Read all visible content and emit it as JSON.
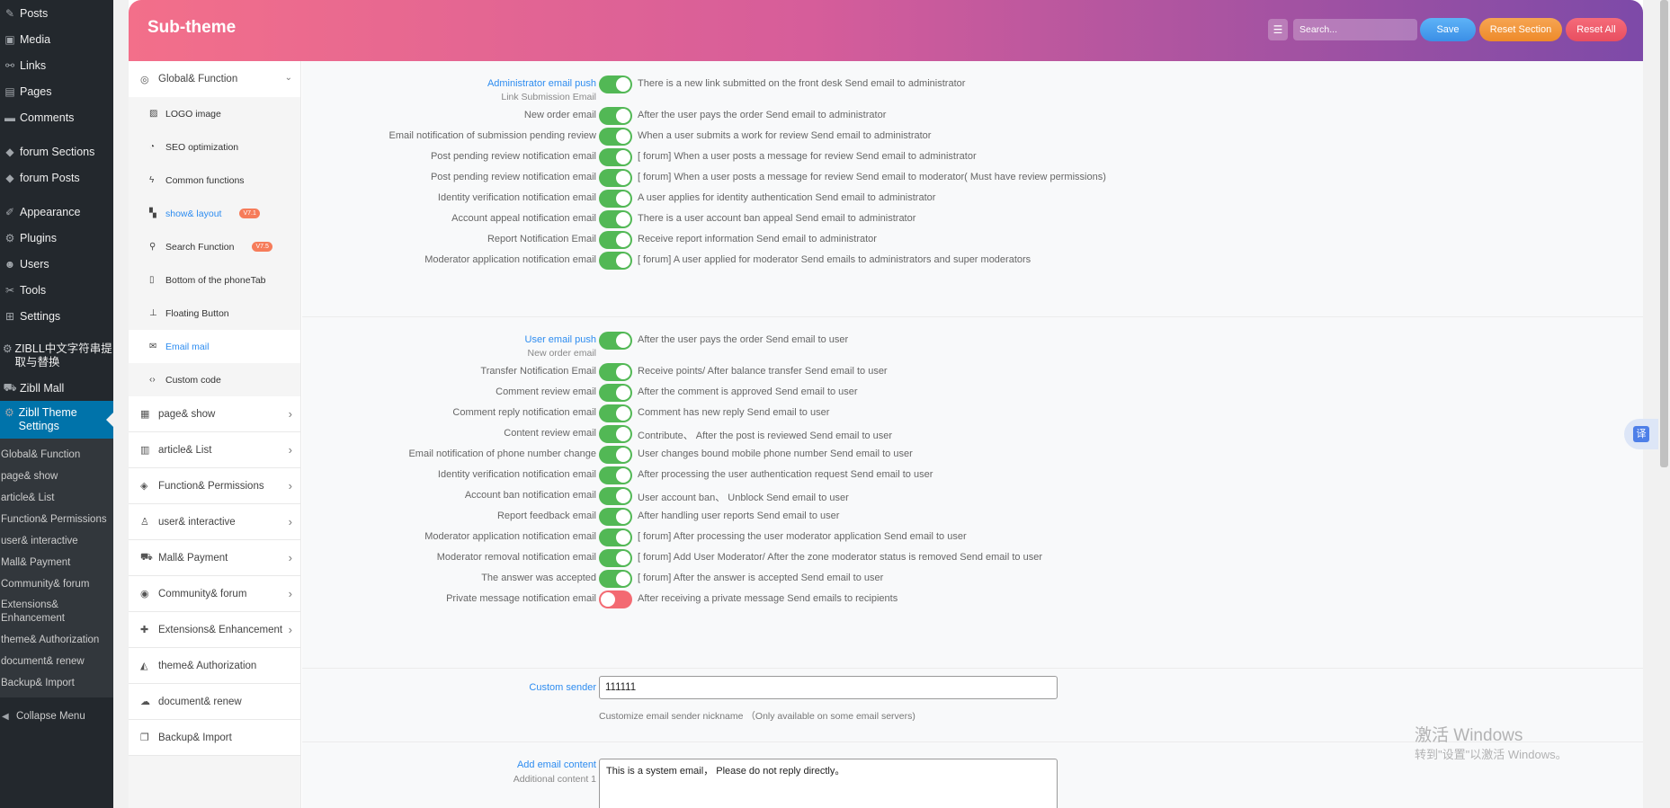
{
  "wp_menu": {
    "items": [
      {
        "icon": "pin-icon",
        "glyph": "✎",
        "label": "Posts"
      },
      {
        "icon": "media-icon",
        "glyph": "▣",
        "label": "Media"
      },
      {
        "icon": "link-icon",
        "glyph": "⚯",
        "label": "Links"
      },
      {
        "icon": "pages-icon",
        "glyph": "▤",
        "label": "Pages"
      },
      {
        "icon": "comments-icon",
        "glyph": "▬",
        "label": "Comments"
      },
      {
        "icon": "forum-icon",
        "glyph": "◆",
        "label": "forum Sections"
      },
      {
        "icon": "forum-posts-icon",
        "glyph": "◆",
        "label": "forum Posts"
      },
      {
        "icon": "appearance-icon",
        "glyph": "✐",
        "label": "Appearance"
      },
      {
        "icon": "plugins-icon",
        "glyph": "⚙",
        "label": "Plugins"
      },
      {
        "icon": "users-icon",
        "glyph": "☻",
        "label": "Users"
      },
      {
        "icon": "tools-icon",
        "glyph": "✂",
        "label": "Tools"
      },
      {
        "icon": "settings-icon",
        "glyph": "⊞",
        "label": "Settings"
      },
      {
        "icon": "gear-icon",
        "glyph": "⚙",
        "label": "ZIBLL中文字符串提取与替换"
      },
      {
        "icon": "cart-icon",
        "glyph": "⛟",
        "label": "Zibll Mall"
      },
      {
        "icon": "gear-icon",
        "glyph": "⚙",
        "label": "Zibll Theme Settings"
      }
    ],
    "sub_items": [
      "Global& Function",
      "page& show",
      "article& List",
      "Function& Permissions",
      "user& interactive",
      "Mall& Payment",
      "Community& forum",
      "Extensions& Enhancement",
      "theme& Authorization",
      "document& renew",
      "Backup& Import"
    ],
    "collapse_label": "Collapse Menu"
  },
  "header": {
    "title": "Sub-theme",
    "search_placeholder": "Search...",
    "save_label": "Save",
    "reset_section_label": "Reset Section",
    "reset_all_label": "Reset All"
  },
  "nav": {
    "open_group": "Global& Function",
    "sub_items": [
      {
        "icon": "image-icon",
        "glyph": "▨",
        "label": "LOGO image"
      },
      {
        "icon": "seo-icon",
        "glyph": "◔",
        "label": "SEO optimization"
      },
      {
        "icon": "bolt-icon",
        "glyph": "ϟ",
        "label": "Common functions"
      },
      {
        "icon": "layout-icon",
        "glyph": "▚",
        "label": "show& layout",
        "badge": "V7.1"
      },
      {
        "icon": "search-icon",
        "glyph": "⚲",
        "label": "Search Function",
        "badge": "V7.5"
      },
      {
        "icon": "phone-icon",
        "glyph": "▯",
        "label": "Bottom of the phoneTab"
      },
      {
        "icon": "thumbtack-icon",
        "glyph": "⊥",
        "label": "Floating Button"
      },
      {
        "icon": "envelope-icon",
        "glyph": "✉",
        "label": "Email mail"
      },
      {
        "icon": "code-icon",
        "glyph": "‹›",
        "label": "Custom code"
      }
    ],
    "groups": [
      {
        "icon": "calendar-icon",
        "glyph": "▦",
        "label": "page& show"
      },
      {
        "icon": "book-icon",
        "glyph": "▥",
        "label": "article& List"
      },
      {
        "icon": "shield-icon",
        "glyph": "◈",
        "label": "Function& Permissions"
      },
      {
        "icon": "user-icon",
        "glyph": "♙",
        "label": "user& interactive"
      },
      {
        "icon": "cart-icon",
        "glyph": "⛟",
        "label": "Mall& Payment"
      },
      {
        "icon": "compass-icon",
        "glyph": "◉",
        "label": "Community& forum"
      },
      {
        "icon": "puzzle-icon",
        "glyph": "✚",
        "label": "Extensions& Enhancement"
      },
      {
        "icon": "gitlab-icon",
        "glyph": "◭",
        "label": "theme& Authorization"
      },
      {
        "icon": "cloud-icon",
        "glyph": "☁",
        "label": "document& renew"
      },
      {
        "icon": "copy-icon",
        "glyph": "❐",
        "label": "Backup& Import"
      }
    ]
  },
  "admin_push": {
    "title": "Administrator email push",
    "subtitle": "Link Submission Email",
    "rows": [
      {
        "label": "",
        "on": true,
        "desc": "There is a new link submitted on the front desk Send email to administrator"
      },
      {
        "label": "New order email",
        "on": true,
        "desc": "After the user pays the order Send email to administrator"
      },
      {
        "label": "Email notification of submission pending review",
        "on": true,
        "desc": "When a user submits a work for review Send email to administrator"
      },
      {
        "label": "Post pending review notification email",
        "on": true,
        "desc": "[ forum] When a user posts a message for review Send email to administrator"
      },
      {
        "label": "Post pending review notification email",
        "on": true,
        "desc": "[ forum] When a user posts a message for review Send email to moderator( Must have review permissions)"
      },
      {
        "label": "Identity verification notification email",
        "on": true,
        "desc": "A user applies for identity authentication Send email to administrator"
      },
      {
        "label": "Account appeal notification email",
        "on": true,
        "desc": "There is a user account ban appeal Send email to administrator"
      },
      {
        "label": "Report Notification Email",
        "on": true,
        "desc": "Receive report information Send email to administrator"
      },
      {
        "label": "Moderator application notification email",
        "on": true,
        "desc": "[ forum] A user applied for moderator Send emails to administrators and super moderators"
      }
    ]
  },
  "user_push": {
    "title": "User email push",
    "subtitle": "New order email",
    "rows": [
      {
        "label": "",
        "on": true,
        "desc": "After the user pays the order Send email to user"
      },
      {
        "label": "Transfer Notification Email",
        "on": true,
        "desc": "Receive points/ After balance transfer Send email to user"
      },
      {
        "label": "Comment review email",
        "on": true,
        "desc": "After the comment is approved Send email to user"
      },
      {
        "label": "Comment reply notification email",
        "on": true,
        "desc": "Comment has new reply Send email to user"
      },
      {
        "label": "Content review email",
        "on": true,
        "desc": "Contribute、 After the post is reviewed Send email to user"
      },
      {
        "label": "Email notification of phone number change",
        "on": true,
        "desc": "User changes bound mobile phone number Send email to user"
      },
      {
        "label": "Identity verification notification email",
        "on": true,
        "desc": "After processing the user authentication request Send email to user"
      },
      {
        "label": "Account ban notification email",
        "on": true,
        "desc": "User account ban、 Unblock Send email to user"
      },
      {
        "label": "Report feedback email",
        "on": true,
        "desc": "After handling user reports Send email to user"
      },
      {
        "label": "Moderator application notification email",
        "on": true,
        "desc": "[ forum] After processing the user moderator application Send email to user"
      },
      {
        "label": "Moderator removal notification email",
        "on": true,
        "desc": "[ forum] Add User Moderator/ After the zone moderator status is removed Send email to user"
      },
      {
        "label": "The answer was accepted",
        "on": true,
        "desc": "[ forum] After the answer is accepted Send email to user"
      },
      {
        "label": "Private message notification email",
        "on": false,
        "desc": "After receiving a private message Send emails to recipients"
      }
    ]
  },
  "custom_sender": {
    "label": "Custom sender",
    "value": "111111",
    "help": "Customize email sender nickname （Only available on some email servers)"
  },
  "email_content": {
    "label": "Add email content",
    "sublabel": "Additional content 1",
    "value": "This is a system email， Please do not reply directly。"
  },
  "watermark": {
    "title": "激活 Windows",
    "subtitle": "转到\"设置\"以激活 Windows。"
  },
  "float_button_glyph": "译"
}
